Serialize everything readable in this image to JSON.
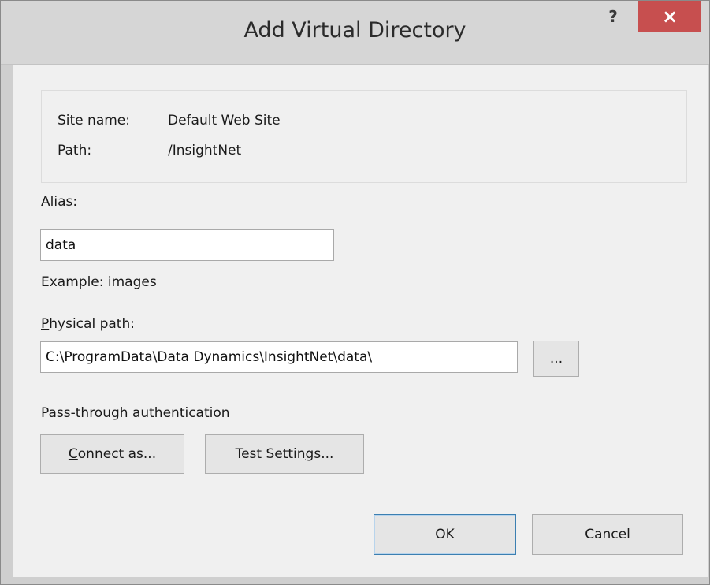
{
  "window": {
    "title": "Add Virtual Directory",
    "help_label": "?",
    "close_label": "×"
  },
  "info": {
    "site_name_label": "Site name:",
    "site_name_value": "Default Web Site",
    "path_label": "Path:",
    "path_value": "/InsightNet"
  },
  "alias": {
    "label_mnemonic": "A",
    "label_rest": "lias:",
    "value": "data",
    "example": "Example: images"
  },
  "physical_path": {
    "label_mnemonic": "P",
    "label_rest": "hysical path:",
    "value": "C:\\ProgramData\\Data Dynamics\\InsightNet\\data\\",
    "browse_label": "..."
  },
  "auth": {
    "label": "Pass-through authentication",
    "connect_mnemonic": "C",
    "connect_rest": "onnect as...",
    "test_before": "Test Settin",
    "test_mnemonic": "g",
    "test_after": "s..."
  },
  "footer": {
    "ok_label": "OK",
    "cancel_label": "Cancel"
  },
  "colors": {
    "close_button_bg": "#c74f4f",
    "default_button_border": "#3c7fb1",
    "client_bg": "#f0f0f0"
  }
}
